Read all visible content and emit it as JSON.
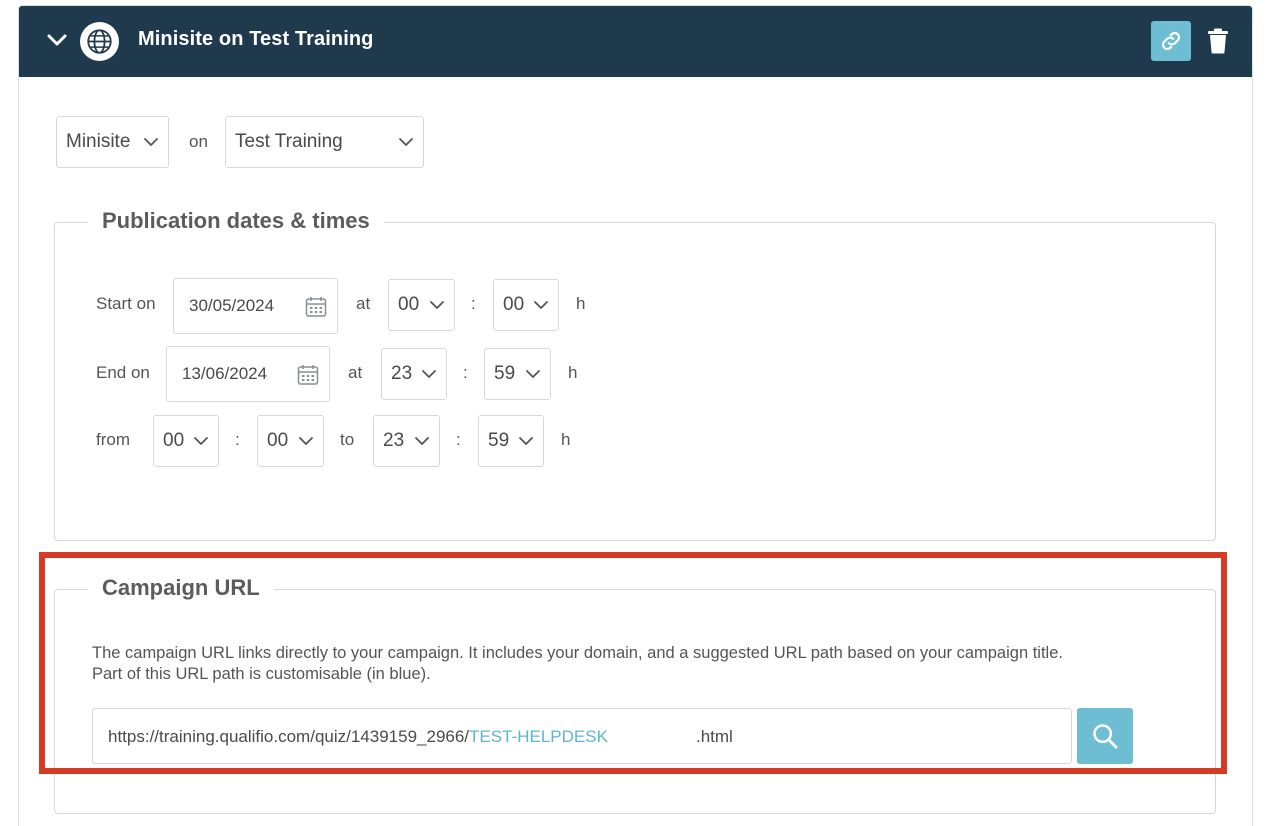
{
  "header": {
    "title": "Minisite on Test Training",
    "bg_color": "#1f3a4d",
    "accent_color": "#6dbdd3"
  },
  "channel": {
    "type_value": "Minisite",
    "on_label": "on",
    "site_value": "Test Training"
  },
  "publication": {
    "legend": "Publication dates & times",
    "start_label": "Start on",
    "start_date": "30/05/2024",
    "start_at_label": "at",
    "start_hour": "00",
    "start_minute": "00",
    "start_h": "h",
    "end_label": "End on",
    "end_date": "13/06/2024",
    "end_at_label": "at",
    "end_hour": "23",
    "end_minute": "59",
    "end_h": "h",
    "from_label": "from",
    "from_hour": "00",
    "from_minute": "00",
    "to_label": "to",
    "to_hour": "23",
    "to_minute": "59",
    "daily_h": "h",
    "colon": ":"
  },
  "campaign_url": {
    "legend": "Campaign URL",
    "description_line1": "The campaign URL links directly to your campaign. It includes your domain, and a suggested URL path based on your campaign title.",
    "description_line2": "Part of this URL path is customisable (in blue).",
    "base_url": "https://training.qualifio.com/quiz/1439159_2966/",
    "custom_path": "TEST-HELPDESK",
    "extension": ".html",
    "highlight_color": "#d43a24"
  }
}
